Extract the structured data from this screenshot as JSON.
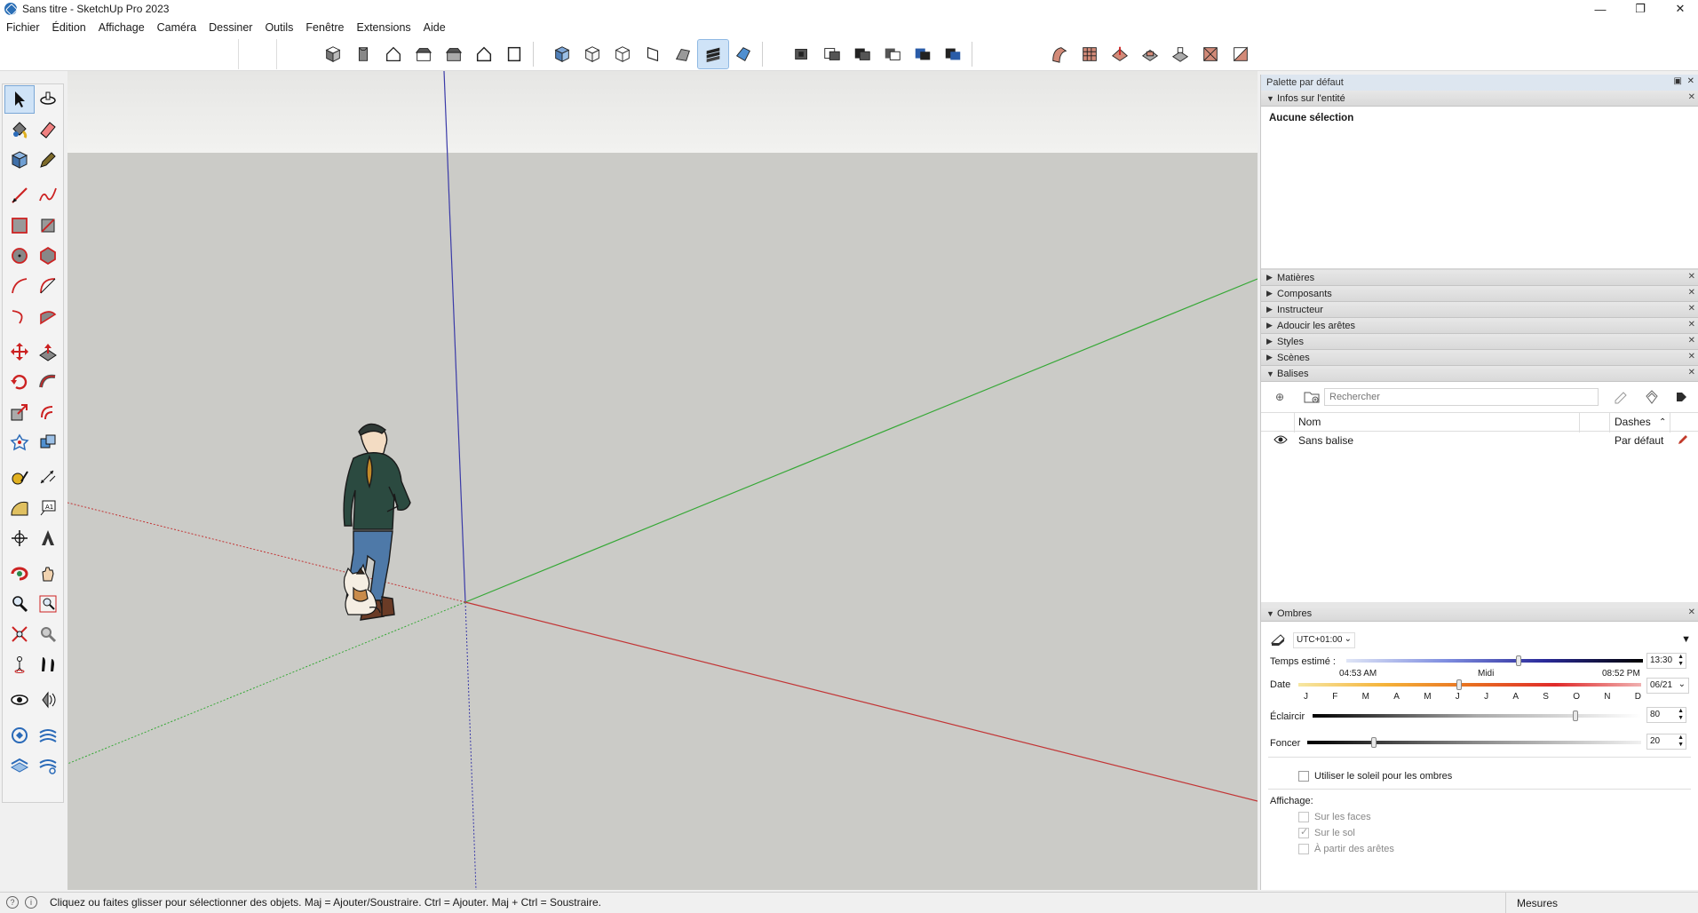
{
  "window": {
    "title": "Sans titre - SketchUp Pro 2023",
    "minimize": "—",
    "restore": "❐",
    "close": "✕"
  },
  "menu": [
    "Fichier",
    "Édition",
    "Affichage",
    "Caméra",
    "Dessiner",
    "Outils",
    "Fenêtre",
    "Extensions",
    "Aide"
  ],
  "toolbar": {
    "views": [
      "iso-view-icon",
      "top-view-icon",
      "front-view-icon",
      "right-view-icon",
      "back-view-icon",
      "left-view-icon",
      "bottom-view-icon"
    ],
    "styles": [
      "xray-icon",
      "back-edges-icon",
      "wireframe-icon",
      "hidden-line-icon",
      "shaded-icon",
      "shaded-textures-icon",
      "monochrome-icon"
    ],
    "active_style": "shaded-textures-icon",
    "sections": [
      "section-plane-icon",
      "display-section-planes-icon",
      "display-section-cuts-icon",
      "section-fill-icon",
      "section-icon-5",
      "section-icon-6"
    ],
    "sandbox": [
      "sandbox-contours-icon",
      "sandbox-scratch-icon",
      "sandbox-smoove-icon",
      "sandbox-stamp-icon",
      "sandbox-drape-icon",
      "sandbox-detail-icon",
      "sandbox-flip-icon"
    ]
  },
  "tools": [
    [
      "select-icon",
      "orbit-small-icon"
    ],
    [
      "paint-bucket-icon",
      "eraser-icon"
    ],
    [
      "component-icon",
      "tag-tool-icon"
    ],
    [
      "line-icon",
      "freehand-icon"
    ],
    [
      "rectangle-icon",
      "rotated-rectangle-icon"
    ],
    [
      "circle-icon",
      "polygon-icon"
    ],
    [
      "arc-icon",
      "two-point-arc-icon"
    ],
    [
      "three-point-arc-icon",
      "pie-icon"
    ],
    [
      "move-icon",
      "push-pull-icon"
    ],
    [
      "rotate-icon",
      "follow-me-icon"
    ],
    [
      "scale-icon",
      "offset-icon"
    ],
    [
      "solid-tools-icon",
      "outer-shell-icon"
    ],
    [
      "tape-measure-icon",
      "dimension-icon"
    ],
    [
      "protractor-icon",
      "text-icon"
    ],
    [
      "axes-icon",
      "3d-text-icon"
    ],
    [
      "orbit-icon",
      "pan-icon"
    ],
    [
      "zoom-icon",
      "zoom-window-icon"
    ],
    [
      "zoom-extents-icon",
      "previous-view-icon"
    ],
    [
      "position-camera-icon",
      "walk-icon"
    ],
    [
      "look-around-icon",
      "section-plane-tool-icon"
    ],
    [
      "warehouse-icon",
      "extension-warehouse-icon"
    ],
    [
      "layout-icon",
      "extension-manager-icon"
    ]
  ],
  "tray": {
    "title": "Palette par défaut",
    "entity_info": {
      "header": "Infos sur l'entité",
      "body": "Aucune sélection"
    },
    "collapsed_panels": [
      "Matières",
      "Composants",
      "Instructeur",
      "Adoucir les arêtes",
      "Styles",
      "Scènes"
    ],
    "tags": {
      "header": "Balises",
      "search_placeholder": "Rechercher",
      "columns": {
        "name": "Nom",
        "dashes": "Dashes"
      },
      "rows": [
        {
          "name": "Sans balise",
          "dashes": "Par défaut"
        }
      ]
    },
    "shadows": {
      "header": "Ombres",
      "timezone": "UTC+01:00",
      "time_label": "Temps estimé :",
      "time_start": "04:53 AM",
      "time_mid": "Midi",
      "time_end": "08:52 PM",
      "time_value": "13:30",
      "time_position": 0.58,
      "date_label": "Date",
      "months": [
        "J",
        "F",
        "M",
        "A",
        "M",
        "J",
        "J",
        "A",
        "S",
        "O",
        "N",
        "D"
      ],
      "date_value": "06/21",
      "date_position": 0.47,
      "light_label": "Éclaircir",
      "light_value": "80",
      "light_position": 0.8,
      "dark_label": "Foncer",
      "dark_value": "20",
      "dark_position": 0.2,
      "use_sun_label": "Utiliser le soleil pour les ombres",
      "display_label": "Affichage:",
      "on_faces": "Sur les faces",
      "on_ground": "Sur le sol",
      "from_edges": "À partir des arêtes"
    }
  },
  "status": {
    "message": "Cliquez ou faites glisser pour sélectionner des objets. Maj = Ajouter/Soustraire. Ctrl = Ajouter. Maj + Ctrl = Soustraire.",
    "measures_label": "Mesures"
  },
  "colors": {
    "sky": "#eeeeec",
    "ground": "#cbcbc7",
    "blue_axis": "#3a3aa8",
    "green_axis": "#36a836",
    "red_axis": "#c23535",
    "accent": "#cfe3f7"
  }
}
